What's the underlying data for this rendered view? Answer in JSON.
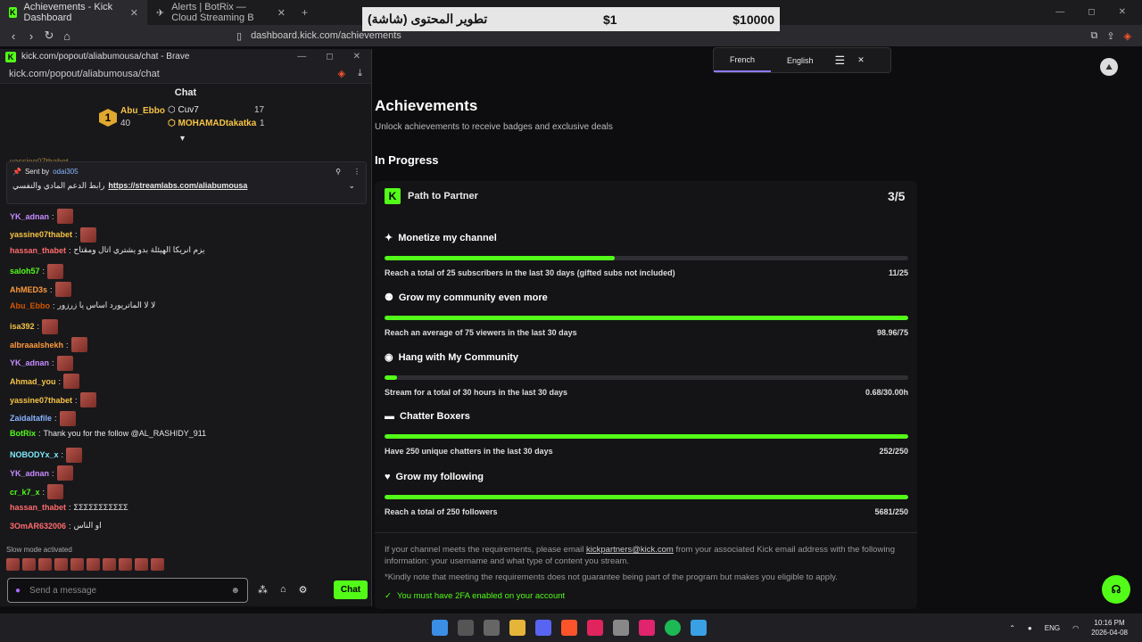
{
  "browser": {
    "tabs": [
      {
        "label": "Achievements - Kick Dashboard",
        "active": true
      },
      {
        "label": "Alerts | BotRix — Cloud Streaming B",
        "active": false
      }
    ],
    "address": "dashboard.kick.com/achievements"
  },
  "donation": {
    "name": "تطوير المحتوى (شاشة)",
    "amount_small": "$1",
    "amount_total": "$10000"
  },
  "popup": {
    "window_title": "kick.com/popout/aliabumousa/chat - Brave",
    "url": "kick.com/popout/aliabumousa/chat",
    "chat_title": "Chat",
    "leaders": {
      "first_name": "Abu_Ebbo",
      "first_count": "40",
      "second_name": "Cuv7",
      "second_count": "17",
      "third_name": "MOHAMADtakatka",
      "third_count": "1"
    },
    "partial_top": "yassine07thabet",
    "pinned": {
      "sent_by": "Sent by",
      "author": "odai305",
      "text": "رابط الدعم المادي والنفسي",
      "link": "https://streamlabs.com/aliabumousa"
    },
    "messages": [
      {
        "user": "YK_adnan",
        "color": "#c78bff",
        "text": ""
      },
      {
        "user": "yassine07thabet",
        "color": "#f6c344",
        "text": ""
      },
      {
        "user": "hassan_thabet",
        "color": "#ff6b6b",
        "text": "يزم انريكا الهيئلة بدو يشتري اتال ومقتاح"
      },
      {
        "user": "saloh57",
        "color": "#53fc18",
        "text": ""
      },
      {
        "user": "AhMED3s",
        "color": "#ff9a3c",
        "text": ""
      },
      {
        "user": "Abu_Ebbo",
        "color": "#d35400",
        "text": "لا لا الماتريورد اساس يا زرزور"
      },
      {
        "user": "isa392",
        "color": "#f6c344",
        "text": ""
      },
      {
        "user": "albraaalshekh",
        "color": "#ff9a3c",
        "text": ""
      },
      {
        "user": "YK_adnan",
        "color": "#c78bff",
        "text": ""
      },
      {
        "user": "Ahmad_you",
        "color": "#f6c344",
        "text": ""
      },
      {
        "user": "yassine07thabet",
        "color": "#f6c344",
        "text": ""
      },
      {
        "user": "Zaidaltafile",
        "color": "#8ab4ff",
        "text": ""
      },
      {
        "user": "BotRix",
        "color": "#53fc18",
        "text": "Thank you for the follow @AL_RASHIDY_911"
      },
      {
        "user": "NOBODYx_x",
        "color": "#7ee8fa",
        "text": ""
      },
      {
        "user": "YK_adnan",
        "color": "#c78bff",
        "text": ""
      },
      {
        "user": "cr_k7_x",
        "color": "#53fc18",
        "text": ""
      },
      {
        "user": "hassan_thabet",
        "color": "#ff6b6b",
        "text": "ΣΣΣΣΣΣΣΣΣΣΣ"
      },
      {
        "user": "3OmAR632006",
        "color": "#ff6b6b",
        "text": "او الناس"
      }
    ],
    "slow_mode": "Slow mode activated",
    "input_placeholder": "Send a message",
    "chat_button": "Chat"
  },
  "lang": {
    "french": "French",
    "english": "English"
  },
  "main": {
    "title": "Achievements",
    "subtitle": "Unlock achievements to receive badges and exclusive deals",
    "section": "In Progress",
    "card_title": "Path to Partner",
    "card_progress": "3/5",
    "goals": [
      {
        "title": "Monetize my channel",
        "desc": "Reach a total of 25 subscribers in the last 30 days (gifted subs not included)",
        "value": "11/25",
        "fill": 0.44
      },
      {
        "title": "Grow my community even more",
        "desc": "Reach an average of 75 viewers in the last 30 days",
        "value": "98.96/75",
        "fill": 1
      },
      {
        "title": "Hang with My Community",
        "desc": "Stream for a total of 30 hours in the last 30 days",
        "value": "0.68/30.00h",
        "fill": 0.023
      },
      {
        "title": "Chatter Boxers",
        "desc": "Have 250 unique chatters in the last 30 days",
        "value": "252/250",
        "fill": 1
      },
      {
        "title": "Grow my following",
        "desc": "Reach a total of 250 followers",
        "value": "5681/250",
        "fill": 1
      }
    ],
    "footer1a": "If your channel meets the requirements, please email ",
    "footer_email": "kickpartners@kick.com",
    "footer1b": " from your associated Kick email address with the following information: your username and what type of content you stream.",
    "footer2": "*Kindly note that meeting the requirements does not guarantee being part of the program but makes you eligible to apply.",
    "twofa": "You must have 2FA enabled on your account"
  },
  "taskbar": {
    "lang": "ENG",
    "time": "10:16 PM",
    "date": "2026-04-08"
  }
}
